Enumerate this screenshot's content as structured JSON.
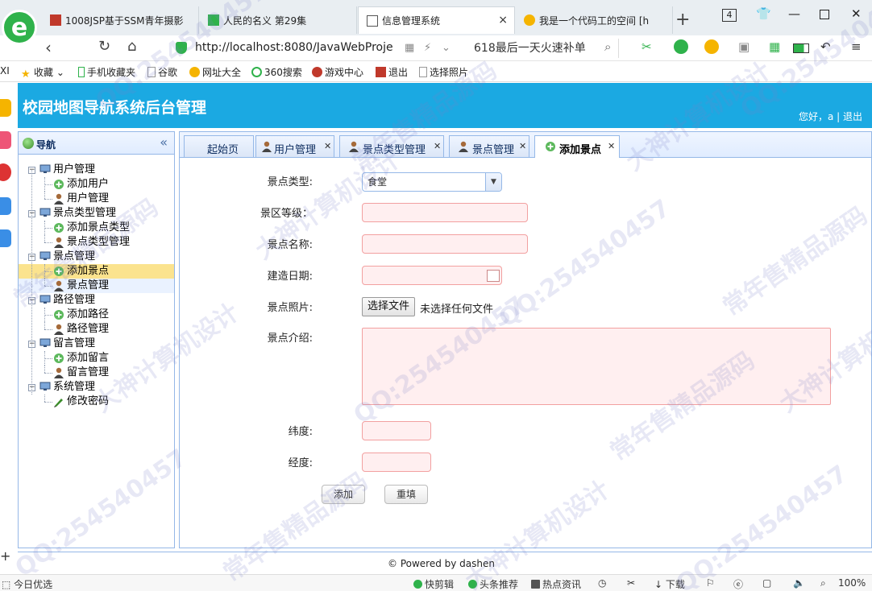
{
  "browser": {
    "logo_letter": "e",
    "tabs": [
      {
        "title": "1008JSP基于SSM青年摄影",
        "active": false
      },
      {
        "title": "人民的名义 第29集",
        "active": false
      },
      {
        "title": "信息管理系统",
        "active": true
      },
      {
        "title": "我是一个代码工的空间 [h",
        "active": false
      }
    ],
    "close_label": "×",
    "new_tab": "+",
    "tab_count": "4",
    "url": "http://localhost:8080/JavaWebProje",
    "promo": "618最后一天火速补单",
    "bookmarks": [
      "收藏",
      "手机收藏夹",
      "谷歌",
      "网址大全",
      "360搜索",
      "游戏中心",
      "退出",
      "选择照片"
    ],
    "left_text": "XI"
  },
  "app": {
    "title": "校园地图导航系统后台管理",
    "welcome_prefix": "您好，a",
    "logout": "退出",
    "nav_title": "导航",
    "collapse": "«",
    "tree": [
      {
        "label": "用户管理",
        "children": [
          "添加用户",
          "用户管理"
        ]
      },
      {
        "label": "景点类型管理",
        "children": [
          "添加景点类型",
          "景点类型管理"
        ]
      },
      {
        "label": "景点管理",
        "children": [
          "添加景点",
          "景点管理"
        ]
      },
      {
        "label": "路径管理",
        "children": [
          "添加路径",
          "路径管理"
        ]
      },
      {
        "label": "留言管理",
        "children": [
          "添加留言",
          "留言管理"
        ]
      },
      {
        "label": "系统管理",
        "children": [
          "修改密码"
        ]
      }
    ],
    "selected_item": "添加景点",
    "tabs": [
      {
        "label": "起始页",
        "closable": false
      },
      {
        "label": "用户管理",
        "closable": true
      },
      {
        "label": "景点类型管理",
        "closable": true
      },
      {
        "label": "景点管理",
        "closable": true
      },
      {
        "label": "添加景点",
        "closable": true,
        "active": true
      }
    ],
    "form": {
      "type_label": "景点类型:",
      "type_value": "食堂",
      "level_label": "景区等级：",
      "level_value": "",
      "name_label": "景点名称:",
      "name_value": "",
      "date_label": "建造日期:",
      "date_value": "",
      "photo_label": "景点照片:",
      "file_button": "选择文件",
      "file_status": "未选择任何文件",
      "intro_label": "景点介绍:",
      "lat_label": "纬度:",
      "lng_label": "经度:",
      "add_button": "添加",
      "reset_button": "重填"
    },
    "footer": "© Powered by dashen"
  },
  "statusbar": {
    "left": "今日优选",
    "items": [
      "快剪辑",
      "头条推荐",
      "热点资讯",
      "下载"
    ],
    "zoom": "100%"
  },
  "watermarks": [
    "QQ:254540457",
    "常年售精品源码",
    "大神计算机设计"
  ],
  "colors": {
    "banner": "#1ba9e2",
    "panel_border": "#95b8e7",
    "selected": "#fbe38e",
    "invalid_fill": "#ffeff0"
  }
}
